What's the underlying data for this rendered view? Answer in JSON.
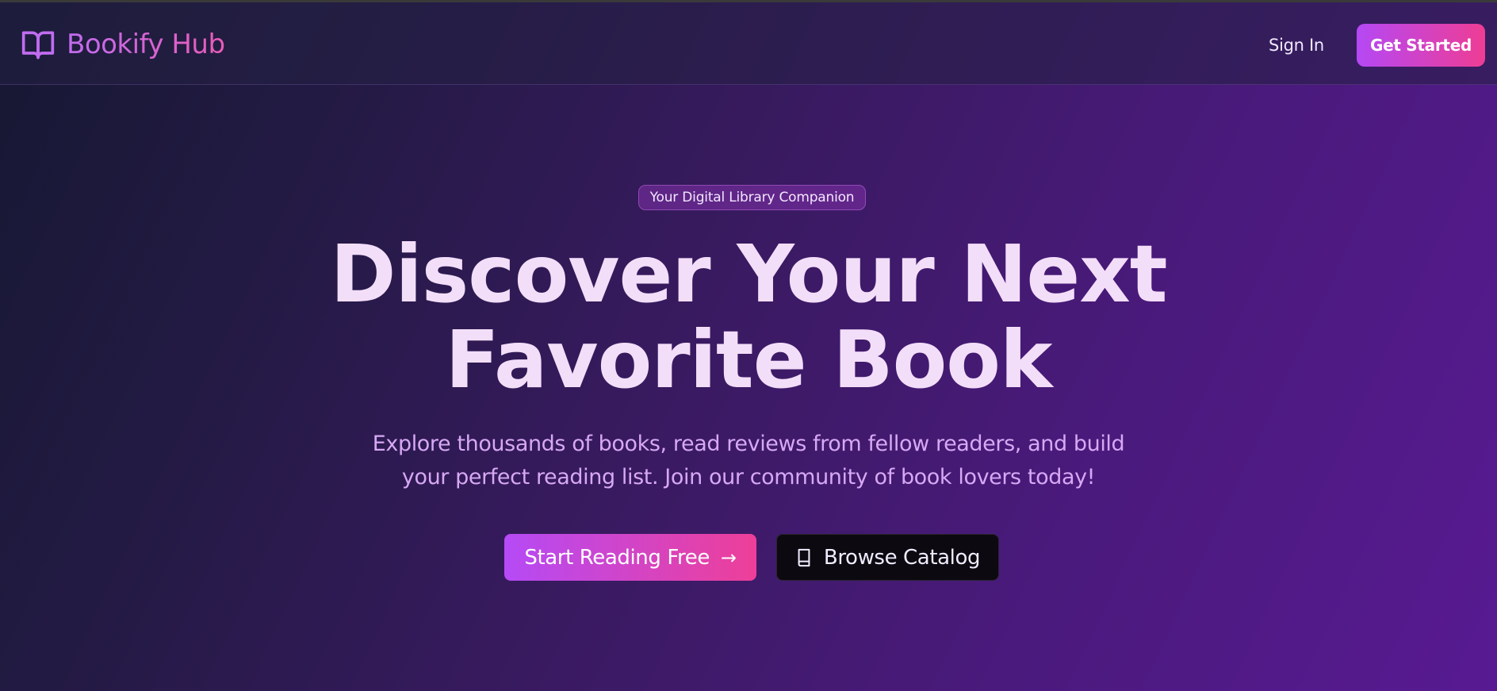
{
  "colors": {
    "brand_gradient_start": "#c06cf0",
    "brand_gradient_end": "#ea5cb8",
    "cta_gradient_start": "#b548f5",
    "cta_gradient_end": "#ee3d94",
    "headline": "#f3def9",
    "subtitle": "#d7a8f4",
    "background_start": "#161832",
    "background_end": "#581a92"
  },
  "header": {
    "logo_icon": "open-book-icon",
    "brand_name": "Bookify Hub",
    "signin_label": "Sign In",
    "get_started_label": "Get Started"
  },
  "hero": {
    "badge": "Your Digital Library Companion",
    "headline_line1": "Discover Your Next",
    "headline_line2": "Favorite Book",
    "subtitle_line1": "Explore thousands of books, read reviews from fellow readers, and build",
    "subtitle_line2": "your perfect reading list. Join our community of book lovers today!",
    "primary_cta": {
      "label": "Start Reading Free",
      "icon": "arrow-right-icon",
      "icon_glyph": "→"
    },
    "secondary_cta": {
      "label": "Browse Catalog",
      "icon": "book-icon"
    }
  }
}
